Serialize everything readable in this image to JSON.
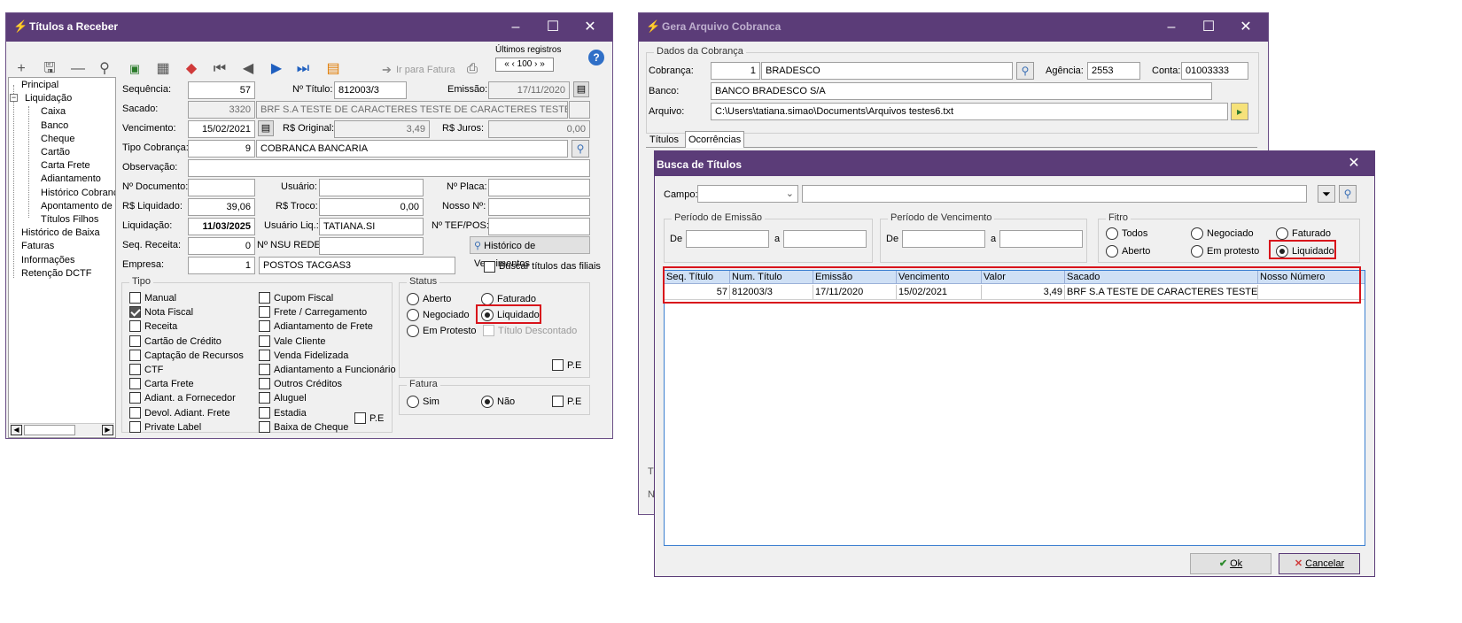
{
  "left_window": {
    "title": "Títulos a Receber",
    "toolbar": {
      "goto_invoice": "Ir para Fatura",
      "last_records_label": "Últimos registros",
      "last_records_value": "100"
    },
    "tree": [
      {
        "label": "Principal",
        "indent": 0
      },
      {
        "label": "Liquidação",
        "indent": 0
      },
      {
        "label": "Caixa",
        "indent": 2
      },
      {
        "label": "Banco",
        "indent": 2
      },
      {
        "label": "Cheque",
        "indent": 2
      },
      {
        "label": "Cartão",
        "indent": 2
      },
      {
        "label": "Carta Frete",
        "indent": 2
      },
      {
        "label": "Adiantamento",
        "indent": 2
      },
      {
        "label": "Histórico Cobrança",
        "indent": 2
      },
      {
        "label": "Apontamento de C",
        "indent": 2
      },
      {
        "label": "Títulos Filhos",
        "indent": 2
      },
      {
        "label": "Histórico de Baixa",
        "indent": 0
      },
      {
        "label": "Faturas",
        "indent": 0
      },
      {
        "label": "Informações",
        "indent": 0
      },
      {
        "label": "Retenção DCTF",
        "indent": 0
      }
    ],
    "form": {
      "sequencia_label": "Sequência:",
      "sequencia": "57",
      "num_titulo_label": "Nº Título:",
      "num_titulo": "812003/3",
      "emissao_label": "Emissão:",
      "emissao": "17/11/2020",
      "sacado_label": "Sacado:",
      "sacado_code": "3320",
      "sacado_name": "BRF S.A TESTE DE CARACTERES TESTE DE CARACTERES TESTE DE CAR",
      "vencimento_label": "Vencimento:",
      "vencimento": "15/02/2021",
      "rs_original_label": "R$ Original:",
      "rs_original": "3,49",
      "rs_juros_label": "R$ Juros:",
      "rs_juros": "0,00",
      "tipo_cobranca_label": "Tipo Cobrança:",
      "tipo_cobranca_code": "9",
      "tipo_cobranca_name": "COBRANCA BANCARIA",
      "observacao_label": "Observação:",
      "num_documento_label": "Nº Documento:",
      "usuario_label": "Usuário:",
      "num_placa_label": "Nº Placa:",
      "rs_liquidado_label": "R$ Liquidado:",
      "rs_liquidado": "39,06",
      "rs_troco_label": "R$ Troco:",
      "rs_troco": "0,00",
      "nosso_num_label": "Nosso Nº:",
      "liquidacao_label": "Liquidação:",
      "liquidacao": "11/03/2025",
      "usuario_liq_label": "Usuário Liq.:",
      "usuario_liq": "TATIANA.SI",
      "num_tef_label": "Nº TEF/POS:",
      "seq_receita_label": "Seq. Receita:",
      "seq_receita": "0",
      "num_nsu_label": "Nº NSU REDE:",
      "historico_btn": "Histórico de Vencimentos",
      "empresa_label": "Empresa:",
      "empresa_code": "1",
      "empresa_name": "POSTOS TACGAS3",
      "buscar_filiais": "Buscar títulos das filiais"
    },
    "tipo": {
      "title": "Tipo",
      "col1": [
        {
          "label": "Manual",
          "checked": false
        },
        {
          "label": "Nota Fiscal",
          "checked": true
        },
        {
          "label": "Receita",
          "checked": false
        },
        {
          "label": "Cartão de Crédito",
          "checked": false
        },
        {
          "label": "Captação de Recursos",
          "checked": false
        },
        {
          "label": "CTF",
          "checked": false
        },
        {
          "label": "Carta Frete",
          "checked": false
        },
        {
          "label": "Adiant. a Fornecedor",
          "checked": false
        },
        {
          "label": "Devol. Adiant. Frete",
          "checked": false
        },
        {
          "label": "Private Label",
          "checked": false
        }
      ],
      "col2": [
        {
          "label": "Cupom Fiscal",
          "checked": false
        },
        {
          "label": "Frete / Carregamento",
          "checked": false
        },
        {
          "label": "Adiantamento de Frete",
          "checked": false
        },
        {
          "label": "Vale Cliente",
          "checked": false
        },
        {
          "label": "Venda Fidelizada",
          "checked": false
        },
        {
          "label": "Adiantamento a Funcionário",
          "checked": false
        },
        {
          "label": "Outros Créditos",
          "checked": false
        },
        {
          "label": "Aluguel",
          "checked": false
        },
        {
          "label": "Estadia",
          "checked": false
        },
        {
          "label": "Baixa de Cheque",
          "checked": false
        }
      ],
      "pe": "P.E"
    },
    "status": {
      "title": "Status",
      "aberto": "Aberto",
      "faturado": "Faturado",
      "negociado": "Negociado",
      "liquidado": "Liquidado",
      "em_protesto": "Em Protesto",
      "titulo_descontado": "Título Descontado",
      "pe": "P.E"
    },
    "fatura": {
      "title": "Fatura",
      "sim": "Sim",
      "nao": "Não",
      "pe": "P.E"
    }
  },
  "right_window": {
    "title": "Gera Arquivo Cobranca",
    "group_title": "Dados da Cobrança",
    "cobranca_label": "Cobrança:",
    "cobranca_code": "1",
    "cobranca_name": "BRADESCO",
    "agencia_label": "Agência:",
    "agencia": "2553",
    "conta_label": "Conta:",
    "conta": "01003333",
    "banco_label": "Banco:",
    "banco": "BANCO BRADESCO S/A",
    "arquivo_label": "Arquivo:",
    "arquivo": "C:\\Users\\tatiana.simao\\Documents\\Arquivos testes6.txt",
    "tabs": [
      "Títulos",
      "Ocorrências"
    ]
  },
  "dialog": {
    "title": "Busca de Títulos",
    "campo_label": "Campo:",
    "periodo_emissao": "Período de Emissão",
    "periodo_vencimento": "Período de Vencimento",
    "de": "De",
    "a": "a",
    "filtro": "Fitro",
    "todos": "Todos",
    "negociado": "Negociado",
    "faturado": "Faturado",
    "aberto": "Aberto",
    "em_protesto": "Em protesto",
    "liquidado": "Liquidado",
    "columns": [
      "Seq. Título",
      "Num. Título",
      "Emissão",
      "Vencimento",
      "Valor",
      "Sacado",
      "Nosso Número"
    ],
    "rows": [
      [
        "57",
        "812003/3",
        "17/11/2020",
        "15/02/2021",
        "3,49",
        "BRF S.A TESTE DE CARACTERES TESTE DE CAR",
        ""
      ]
    ],
    "ok": "Ok",
    "cancel": "Cancelar"
  },
  "colors": {
    "titlebar": "#5b3c78",
    "highlight": "#d8131b",
    "grid_header": "#cfe0f5",
    "accent": "#2f8ddb"
  }
}
